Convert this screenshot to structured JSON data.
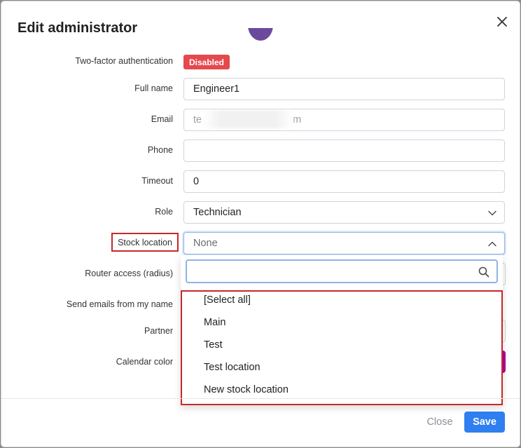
{
  "modal": {
    "title": "Edit administrator",
    "close_icon": "close-icon"
  },
  "form": {
    "two_factor": {
      "label": "Two-factor authentication",
      "status": "Disabled",
      "status_color": "#e5484d"
    },
    "full_name": {
      "label": "Full name",
      "value": "Engineer1"
    },
    "email": {
      "label": "Email",
      "value_start": "te",
      "value_end": "m"
    },
    "phone": {
      "label": "Phone",
      "value": ""
    },
    "timeout": {
      "label": "Timeout",
      "value": "0"
    },
    "role": {
      "label": "Role",
      "value": "Technician"
    },
    "stock_location": {
      "label": "Stock location",
      "value": "None"
    },
    "router_access": {
      "label": "Router access (radius)"
    },
    "send_emails": {
      "label": "Send emails from my name"
    },
    "partner": {
      "label": "Partner"
    },
    "calendar_color": {
      "label": "Calendar color",
      "color": "#b0009a"
    }
  },
  "dropdown": {
    "search_placeholder": "",
    "options": [
      "[Select all]",
      "Main",
      "Test",
      "Test location",
      "New stock location"
    ]
  },
  "footer": {
    "close_label": "Close",
    "save_label": "Save",
    "accent": "#2f7ff0"
  }
}
